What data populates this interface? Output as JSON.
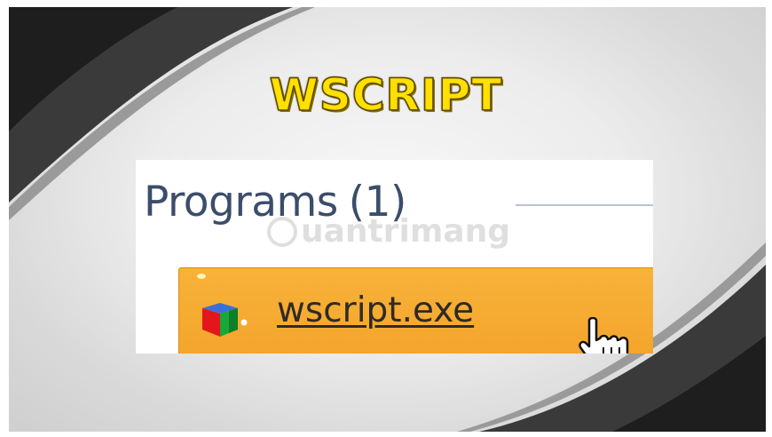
{
  "title": "WSCRIPT",
  "search_results": {
    "group_heading": "Programs",
    "group_count": "(1)",
    "items": [
      {
        "label": "wscript.exe",
        "icon": "script-exe-icon"
      }
    ]
  },
  "watermark": "uantrimang",
  "colors": {
    "title_fill": "#ffe000",
    "title_outline": "#5c4a00",
    "highlight": "#f4a52c",
    "heading_text": "#3b4d6b"
  }
}
